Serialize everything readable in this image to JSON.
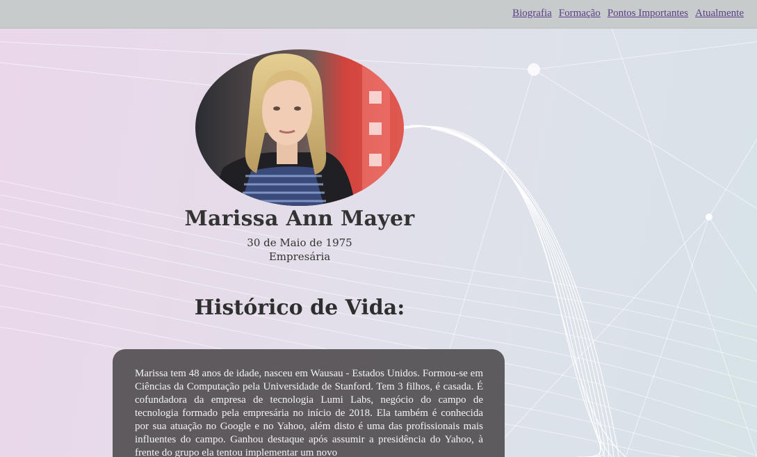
{
  "nav": {
    "items": [
      {
        "label": "Biografia"
      },
      {
        "label": "Formação"
      },
      {
        "label": "Pontos Importantes"
      },
      {
        "label": "Atualmente"
      }
    ]
  },
  "profile": {
    "name": "Marissa Ann Mayer",
    "birth_date": "30 de Maio de 1975",
    "occupation": "Empresária"
  },
  "history": {
    "title": "Histórico de Vida:",
    "text": "Marissa tem 48 anos de idade, nasceu em Wausau - Estados Unidos. Formou-se em Ciências da Computação pela Universidade de Stanford. Tem 3 filhos, é casada. É cofundadora da empresa de tecnologia Lumi Labs, negócio do campo de tecnologia formado pela empresária no início de 2018. Ela também é conhecida por sua atuação no Google e no Yahoo, além disto é uma das profissionais mais influentes do campo. Ganhou destaque após assumir a presidência do Yahoo, à frente do grupo ela tentou implementar um novo"
  },
  "colors": {
    "topbar": "#c7cbcc",
    "link": "#5b3c88",
    "card": "#4b484a",
    "heading": "#333333"
  }
}
